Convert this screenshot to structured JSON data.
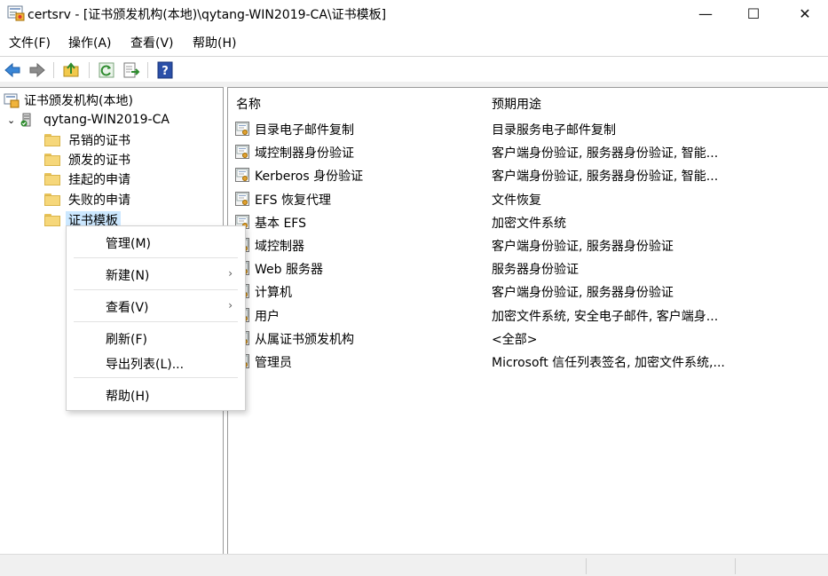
{
  "window": {
    "title": "certsrv - [证书颁发机构(本地)\\qytang-WIN2019-CA\\证书模板]",
    "minimize": "—",
    "maximize": "☐",
    "close": "✕"
  },
  "menubar": {
    "items": [
      {
        "label": "文件(F)"
      },
      {
        "label": "操作(A)"
      },
      {
        "label": "查看(V)"
      },
      {
        "label": "帮助(H)"
      }
    ]
  },
  "toolbar": {
    "icons": [
      "back-arrow-icon",
      "forward-arrow-icon",
      "up-folder-icon",
      "refresh-icon",
      "export-list-icon",
      "help-icon"
    ]
  },
  "tree": {
    "root": "证书颁发机构(本地)",
    "ca": "qytang-WIN2019-CA",
    "items": [
      {
        "label": "吊销的证书"
      },
      {
        "label": "颁发的证书"
      },
      {
        "label": "挂起的申请"
      },
      {
        "label": "失败的申请"
      },
      {
        "label": "证书模板",
        "selected": true
      }
    ]
  },
  "list": {
    "columns": {
      "name": "名称",
      "purpose": "预期用途"
    },
    "rows": [
      {
        "name": "目录电子邮件复制",
        "purpose": "目录服务电子邮件复制"
      },
      {
        "name": "域控制器身份验证",
        "purpose": "客户端身份验证, 服务器身份验证, 智能..."
      },
      {
        "name": "Kerberos 身份验证",
        "purpose": "客户端身份验证, 服务器身份验证, 智能..."
      },
      {
        "name": "EFS 恢复代理",
        "purpose": "文件恢复"
      },
      {
        "name": "基本 EFS",
        "purpose": "加密文件系统"
      },
      {
        "name": "域控制器",
        "purpose": "客户端身份验证, 服务器身份验证"
      },
      {
        "name": "Web 服务器",
        "purpose": "服务器身份验证"
      },
      {
        "name": "计算机",
        "purpose": "客户端身份验证, 服务器身份验证"
      },
      {
        "name": "用户",
        "purpose": "加密文件系统, 安全电子邮件, 客户端身..."
      },
      {
        "name": "从属证书颁发机构",
        "purpose": "<全部>"
      },
      {
        "name": "管理员",
        "purpose": "Microsoft 信任列表签名, 加密文件系统,..."
      }
    ]
  },
  "context_menu": {
    "manage": "管理(M)",
    "new": "新建(N)",
    "view": "查看(V)",
    "refresh": "刷新(F)",
    "export": "导出列表(L)...",
    "help": "帮助(H)",
    "submenu_arrow": "›"
  }
}
